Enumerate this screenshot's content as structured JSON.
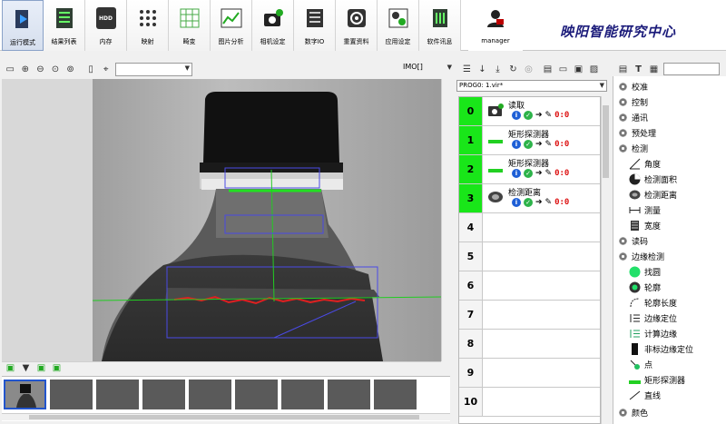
{
  "toolbar": {
    "items": [
      {
        "label": "运行模式",
        "icon": "run-mode-icon"
      },
      {
        "label": "结果列表",
        "icon": "results-list-icon"
      },
      {
        "label": "内存",
        "icon": "memory-icon",
        "badge": "HDD"
      },
      {
        "label": "映射",
        "icon": "mapping-icon"
      },
      {
        "label": "畸变",
        "icon": "distortion-icon"
      },
      {
        "label": "图片分析",
        "icon": "image-analysis-icon"
      },
      {
        "label": "相机设定",
        "icon": "camera-settings-icon"
      },
      {
        "label": "数字IO",
        "icon": "digital-io-icon"
      },
      {
        "label": "重置资料",
        "icon": "reset-data-icon"
      },
      {
        "label": "应用设定",
        "icon": "app-settings-icon"
      },
      {
        "label": "软件讯息",
        "icon": "software-info-icon"
      },
      {
        "label": "manager",
        "icon": "user-icon"
      }
    ],
    "brand": "映阳智能研究中心"
  },
  "image_panel": {
    "zoom_combo_value": "",
    "image_selector": "IMO[]"
  },
  "flow_panel": {
    "program_select": "PROG0: 1.vir*",
    "steps": [
      {
        "num": "0",
        "name": "读取",
        "active": true,
        "icon": "camera-icon"
      },
      {
        "num": "1",
        "name": "矩形探测器",
        "active": true,
        "icon": "rect-detector-icon"
      },
      {
        "num": "2",
        "name": "矩形探测器",
        "active": true,
        "icon": "rect-detector-icon"
      },
      {
        "num": "3",
        "name": "检测距离",
        "active": true,
        "icon": "distance-icon"
      },
      {
        "num": "4",
        "name": "",
        "active": false
      },
      {
        "num": "5",
        "name": "",
        "active": false
      },
      {
        "num": "6",
        "name": "",
        "active": false
      },
      {
        "num": "7",
        "name": "",
        "active": false
      },
      {
        "num": "8",
        "name": "",
        "active": false
      },
      {
        "num": "9",
        "name": "",
        "active": false
      },
      {
        "num": "10",
        "name": "",
        "active": false
      }
    ],
    "ctl_text": "0:0"
  },
  "tree": {
    "items": [
      {
        "label": "校准",
        "level": 0
      },
      {
        "label": "控制",
        "level": 0
      },
      {
        "label": "通讯",
        "level": 0
      },
      {
        "label": "预处理",
        "level": 0
      },
      {
        "label": "检测",
        "level": 0
      },
      {
        "label": "角度",
        "level": 1,
        "icon": "angle-icon"
      },
      {
        "label": "检测面积",
        "level": 1,
        "icon": "area-icon"
      },
      {
        "label": "检测距离",
        "level": 1,
        "icon": "distance-icon"
      },
      {
        "label": "测量",
        "level": 1,
        "icon": "measure-icon"
      },
      {
        "label": "宽度",
        "level": 1,
        "icon": "width-icon"
      },
      {
        "label": "读码",
        "level": 0
      },
      {
        "label": "边缘检测",
        "level": 0
      },
      {
        "label": "找圆",
        "level": 1,
        "icon": "find-circle-icon"
      },
      {
        "label": "轮廓",
        "level": 1,
        "icon": "contour-icon"
      },
      {
        "label": "轮廓长度",
        "level": 1,
        "icon": "contour-length-icon"
      },
      {
        "label": "边缘定位",
        "level": 1,
        "icon": "edge-locate-icon"
      },
      {
        "label": "计算边缘",
        "level": 1,
        "icon": "calc-edge-icon"
      },
      {
        "label": "非标边缘定位",
        "level": 1,
        "icon": "nonstd-edge-icon"
      },
      {
        "label": "点",
        "level": 1,
        "icon": "point-icon"
      },
      {
        "label": "矩形探测器",
        "level": 1,
        "icon": "rect-detector-icon"
      },
      {
        "label": "直线",
        "level": 1,
        "icon": "line-icon"
      },
      {
        "label": "颜色",
        "level": 0
      }
    ]
  },
  "colors": {
    "accent_green": "#19e619",
    "brand": "#1b1b7a",
    "roi_blue": "#4a4ae6"
  }
}
